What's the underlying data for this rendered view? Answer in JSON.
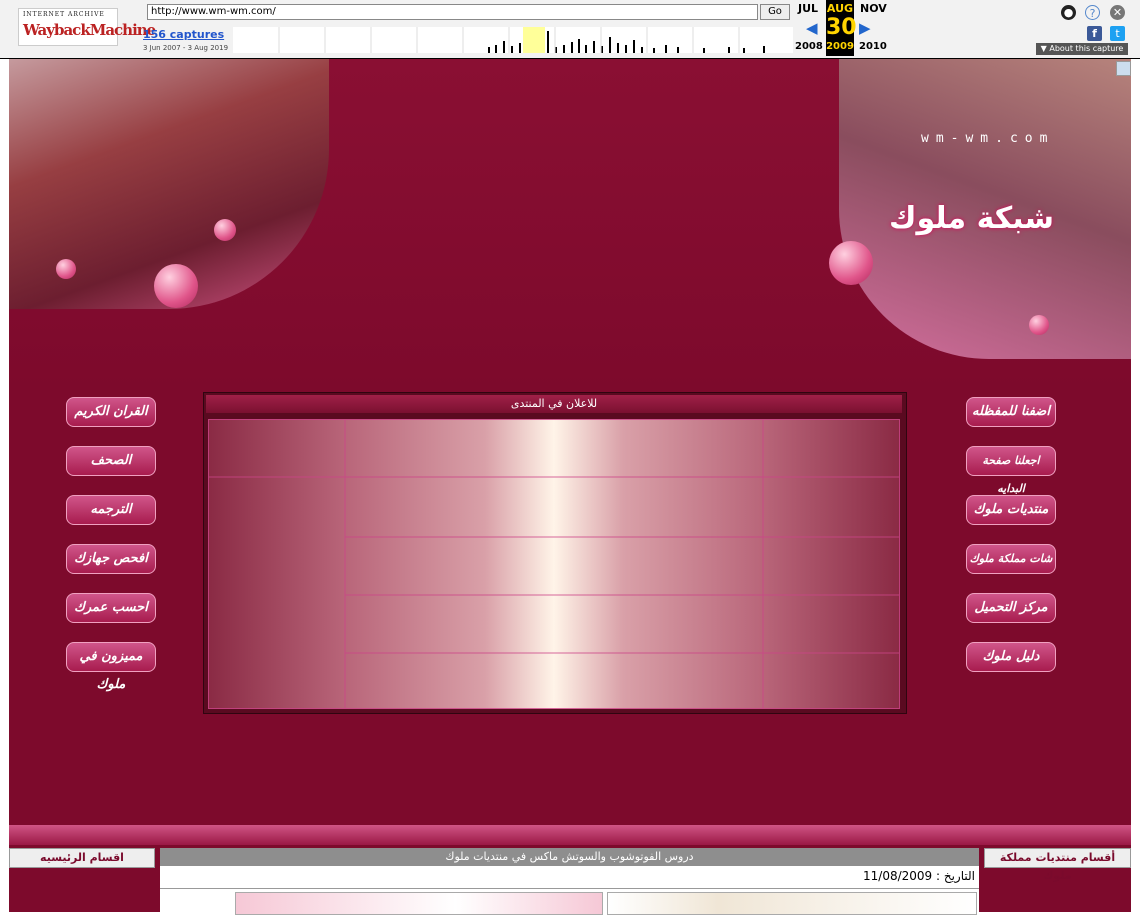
{
  "wayback": {
    "logo_top": "INTERNET ARCHIVE",
    "logo_main": "WaybackMachine",
    "url": "http://www.wm-wm.com/",
    "go_label": "Go",
    "captures": "156 captures",
    "range": "3 Jun 2007 - 3 Aug 2019",
    "months": {
      "prev": "JUL",
      "cur": "AUG",
      "next": "NOV"
    },
    "day": "30",
    "years": {
      "prev": "2008",
      "cur": "2009",
      "next": "2010"
    },
    "about": "About this capture"
  },
  "header": {
    "site_url": "wm-wm.com",
    "site_name": "شبكة ملوك"
  },
  "nav_left": [
    {
      "label": "القران الكريم"
    },
    {
      "label": "الصحف"
    },
    {
      "label": "الترجمه"
    },
    {
      "label": "افحص جهازك"
    },
    {
      "label": "احسب عمرك"
    },
    {
      "label": "مميزون في ملوك"
    }
  ],
  "nav_right": [
    {
      "label": "اضفنا للمفظله"
    },
    {
      "label": "اجعلنا صفحة البدايه"
    },
    {
      "label": "منتديات ملوك"
    },
    {
      "label": "شات مملكة ملوك"
    },
    {
      "label": "مركز التحميل"
    },
    {
      "label": "دليل ملوك"
    }
  ],
  "ad": {
    "title": "للاعلان في المنتدى"
  },
  "columns": {
    "left_title": "اقسام الرئيسيه",
    "center_title": "دروس الفوتوشوب والسوتش ماكس في منتديات ملوك",
    "date": "التاريخ : 11/08/2009",
    "right_title": "أقسام منتديات مملكة ملوك"
  }
}
